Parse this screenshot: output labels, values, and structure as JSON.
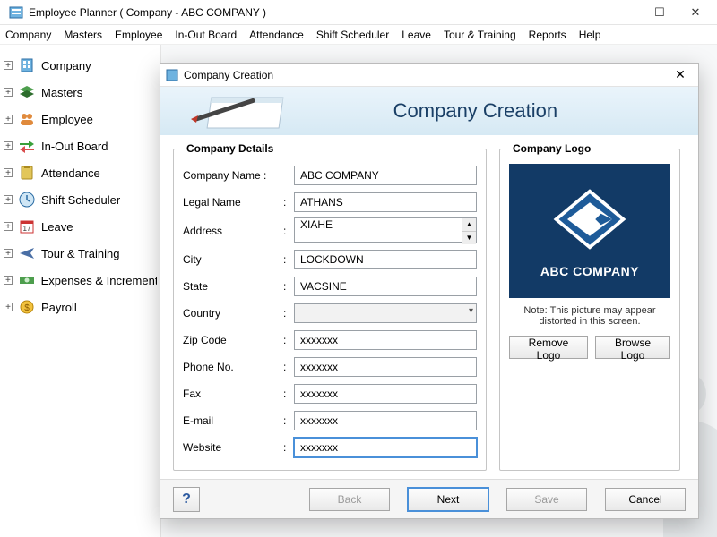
{
  "window": {
    "title": "Employee Planner ( Company - ABC COMPANY )"
  },
  "menu": [
    "Company",
    "Masters",
    "Employee",
    "In-Out Board",
    "Attendance",
    "Shift Scheduler",
    "Leave",
    "Tour & Training",
    "Reports",
    "Help"
  ],
  "sidebar": {
    "items": [
      {
        "label": "Company"
      },
      {
        "label": "Masters"
      },
      {
        "label": "Employee"
      },
      {
        "label": "In-Out Board"
      },
      {
        "label": "Attendance"
      },
      {
        "label": "Shift Scheduler"
      },
      {
        "label": "Leave"
      },
      {
        "label": "Tour & Training"
      },
      {
        "label": "Expenses & Increment"
      },
      {
        "label": "Payroll"
      }
    ]
  },
  "dialog": {
    "title": "Company Creation",
    "heading": "Company Creation",
    "details_legend": "Company Details",
    "logo_legend": "Company Logo",
    "fields": {
      "company_name": {
        "label": "Company Name :",
        "value": "ABC COMPANY"
      },
      "legal_name": {
        "label": "Legal Name",
        "value": "ATHANS"
      },
      "address": {
        "label": "Address",
        "value": "XIAHE"
      },
      "city": {
        "label": "City",
        "value": "LOCKDOWN"
      },
      "state": {
        "label": "State",
        "value": "VACSINE"
      },
      "country": {
        "label": "Country",
        "value": ""
      },
      "zip": {
        "label": "Zip Code",
        "value": "xxxxxxx"
      },
      "phone": {
        "label": "Phone No.",
        "value": "xxxxxxx"
      },
      "fax": {
        "label": "Fax",
        "value": "xxxxxxx"
      },
      "email": {
        "label": "E-mail",
        "value": "xxxxxxx"
      },
      "website": {
        "label": "Website",
        "value": "xxxxxxx"
      }
    },
    "logo": {
      "company_text": "ABC COMPANY",
      "note": "Note: This picture may appear distorted in this screen.",
      "remove": "Remove Logo",
      "browse": "Browse Logo"
    },
    "buttons": {
      "help": "?",
      "back": "Back",
      "next": "Next",
      "save": "Save",
      "cancel": "Cancel"
    }
  }
}
